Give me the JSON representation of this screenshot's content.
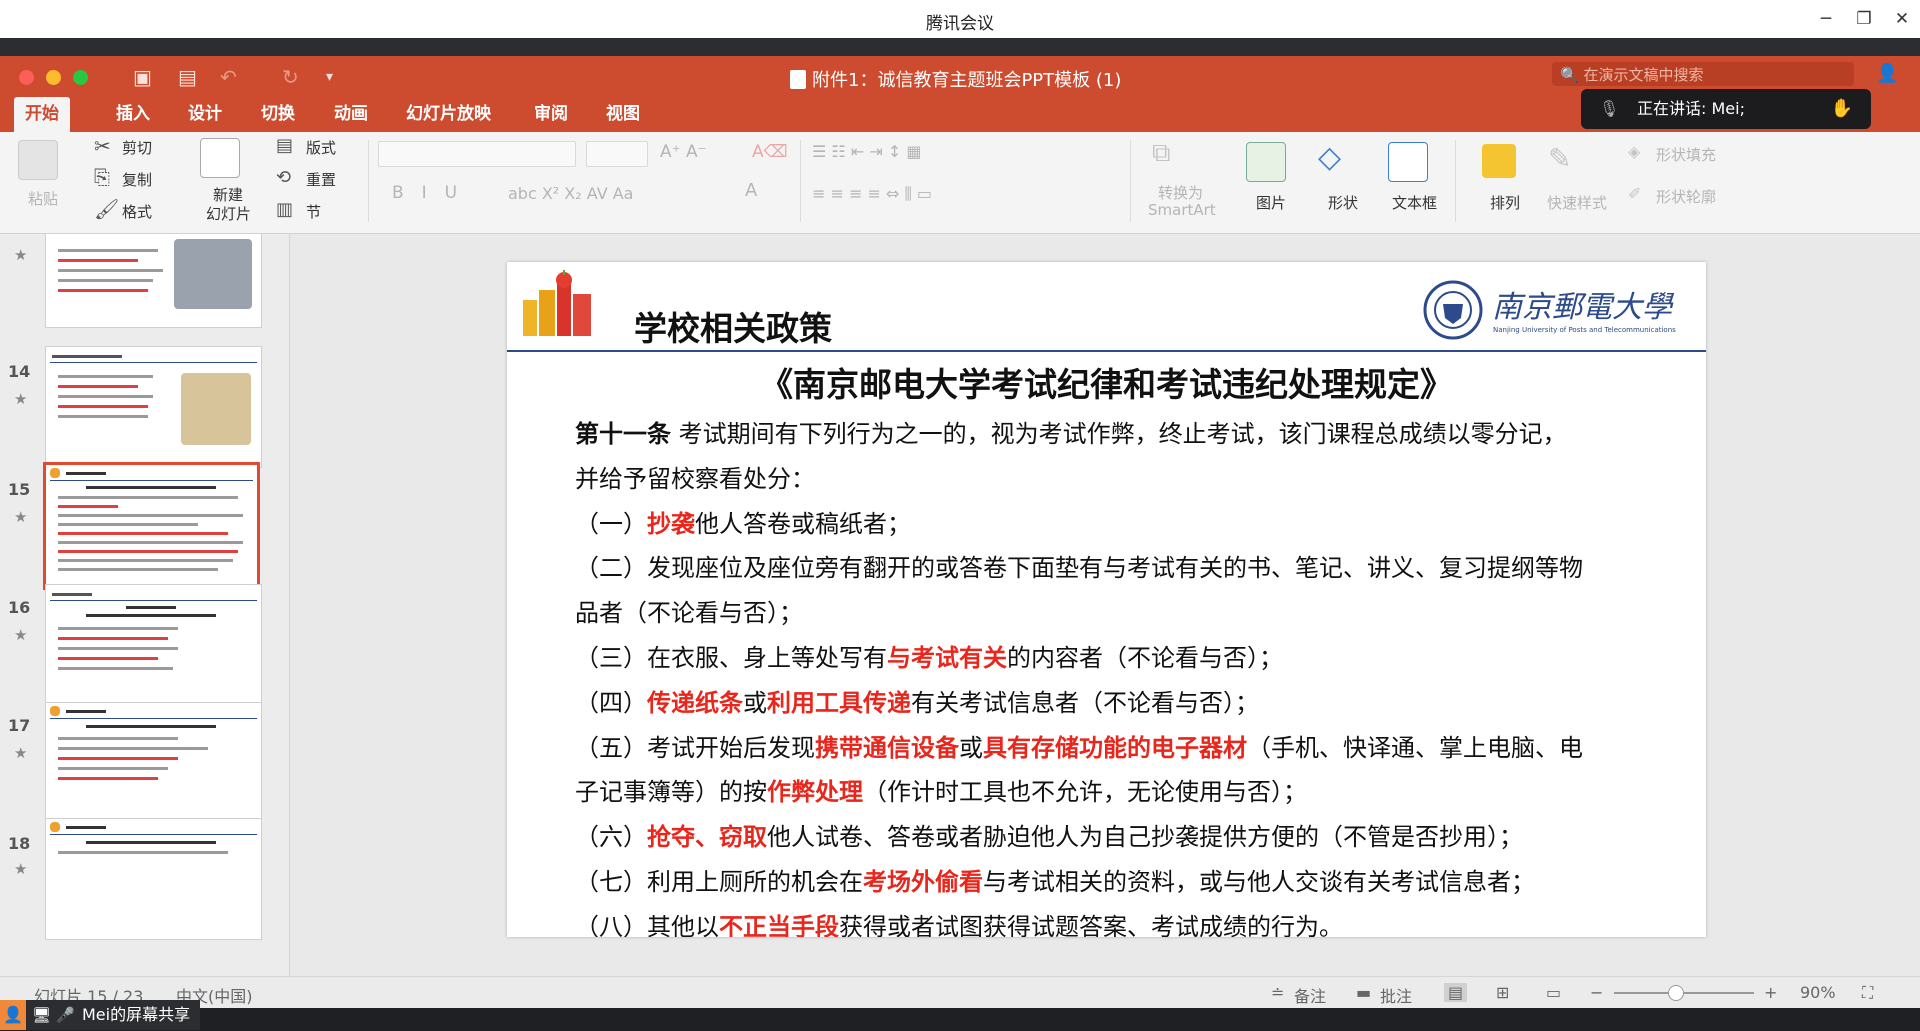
{
  "meeting": {
    "app_title": "腾讯会议",
    "speaker_label": "正在讲话: Mei;",
    "share_label": "Mei的屏幕共享"
  },
  "ppt": {
    "doc_title": "附件1：诚信教育主题班会PPT模板 (1)",
    "search_placeholder": "在演示文稿中搜索",
    "tabs": [
      "开始",
      "插入",
      "设计",
      "切换",
      "动画",
      "幻灯片放映",
      "审阅",
      "视图"
    ],
    "ribbon": {
      "paste": "粘贴",
      "cut": "剪切",
      "copy": "复制",
      "format": "格式",
      "new_slide_1": "新建",
      "new_slide_2": "幻灯片",
      "layout": "版式",
      "reset": "重置",
      "section": "节",
      "convert_1": "转换为",
      "convert_2": "SmartArt",
      "picture": "图片",
      "shape": "形状",
      "textbox": "文本框",
      "arrange": "排列",
      "quick_styles": "快速样式",
      "shape_fill": "形状填充",
      "shape_outline": "形状轮廓"
    },
    "thumbnails": [
      {
        "num": "",
        "selected": false
      },
      {
        "num": "14",
        "selected": false
      },
      {
        "num": "15",
        "selected": true
      },
      {
        "num": "16",
        "selected": false
      },
      {
        "num": "17",
        "selected": false
      },
      {
        "num": "18",
        "selected": false
      }
    ],
    "status": {
      "slide_pos": "幻灯片 15 / 23",
      "language": "中文(中国)",
      "notes": "备注",
      "comments": "批注",
      "zoom": "90%"
    }
  },
  "slide": {
    "header": "学校相关政策",
    "university_cn": "南京郵電大學",
    "university_en": "Nanjing University of Posts and Telecommunications",
    "title": "《南京邮电大学考试纪律和考试违纪处理规定》",
    "article_label": "第十一条",
    "lines": {
      "l1": "考试期间有下列行为之一的，视为考试作弊，终止考试，该门课程总成绩以零分记，",
      "l2": "并给予留校察看处分：",
      "i1_a": "（一）",
      "i1_red": "抄袭",
      "i1_b": "他人答卷或稿纸者；",
      "i2_a": "（二）发现座位及座位旁有翻开的或答卷下面垫有与考试有关的书、笔记、讲义、复习提纲等物",
      "i2_b": "品者（不论看与否）；",
      "i3_a": "（三）在衣服、身上等处写有",
      "i3_red": "与考试有关",
      "i3_b": "的内容者（不论看与否）；",
      "i4_a": "（四）",
      "i4_red1": "传递纸条",
      "i4_b": "或",
      "i4_red2": "利用工具传递",
      "i4_c": "有关考试信息者（不论看与否）；",
      "i5_a": "（五）考试开始后发现",
      "i5_red1": "携带通信设备",
      "i5_b": "或",
      "i5_red2": "具有存储功能的电子器材",
      "i5_c": "（手机、快译通、掌上电脑、电",
      "i5_d": "子记事簿等）的按",
      "i5_red3": "作弊处理",
      "i5_e": "（作计时工具也不允许，无论使用与否）；",
      "i6_a": "（六）",
      "i6_red": "抢夺、窃取",
      "i6_b": "他人试卷、答卷或者胁迫他人为自己抄袭提供方便的（不管是否抄用）；",
      "i7_a": "（七）利用上厕所的机会在",
      "i7_red": "考场外偷看",
      "i7_b": "与考试相关的资料，或与他人交谈有关考试信息者；",
      "i8_a": "（八）其他以",
      "i8_red": "不正当手段",
      "i8_b": "获得或者试图获得试题答案、考试成绩的行为。"
    }
  },
  "colors": {
    "ppt_red": "#cd4b2f",
    "highlight_red": "#e8261c",
    "univ_blue": "#2d4a8c"
  }
}
